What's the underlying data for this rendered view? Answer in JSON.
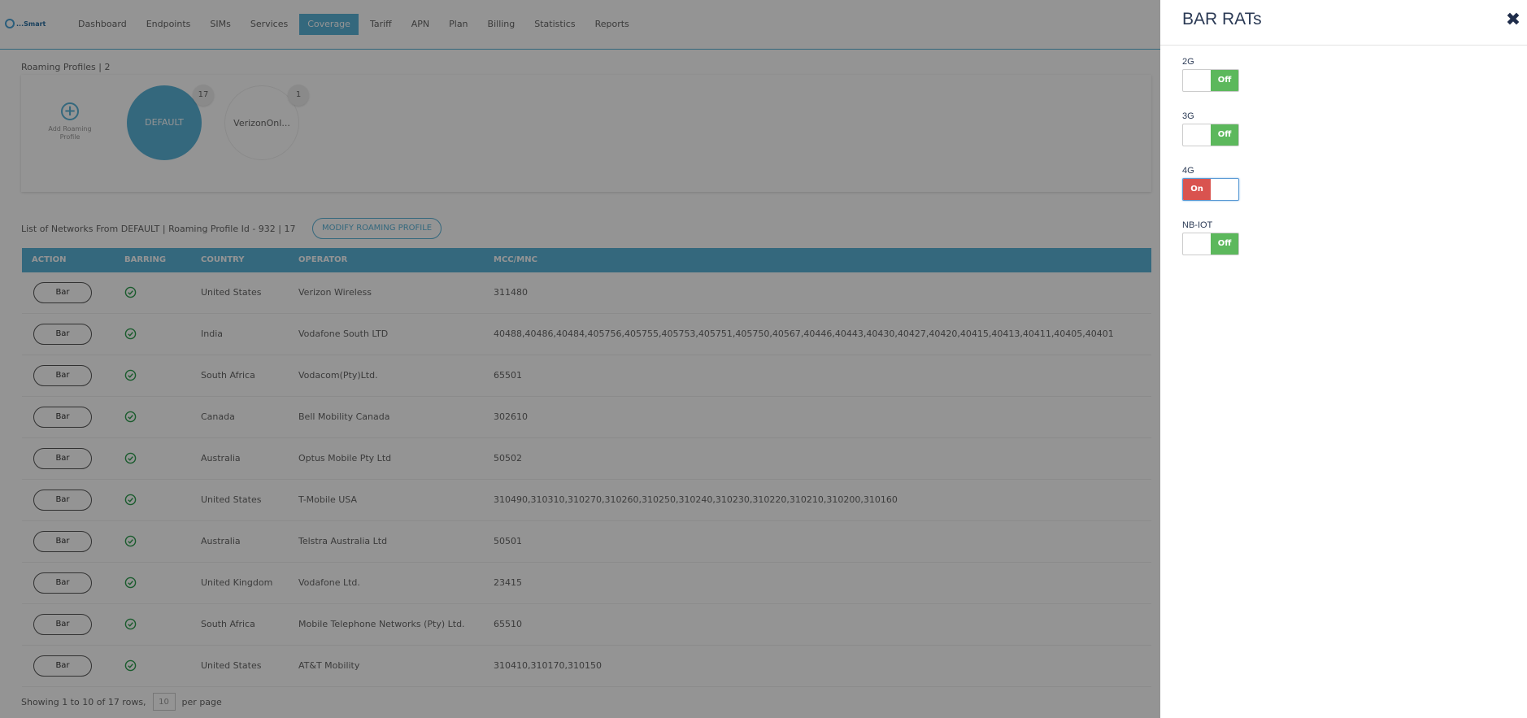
{
  "header": {
    "logo_text": "...Smart",
    "nav": [
      "Dashboard",
      "Endpoints",
      "SIMs",
      "Services",
      "Coverage",
      "Tariff",
      "APN",
      "Plan",
      "Billing",
      "Statistics",
      "Reports"
    ],
    "active_nav": "Coverage"
  },
  "profiles": {
    "heading": "Roaming Profiles  |  2",
    "add_label": "Add Roaming Profile",
    "items": [
      {
        "name": "DEFAULT",
        "count": "17"
      },
      {
        "name": "VerizonOnl...",
        "count": "1"
      }
    ]
  },
  "list": {
    "title": "List of Networks From DEFAULT | Roaming Profile Id - 932  |  17",
    "modify_label": "MODIFY ROAMING PROFILE",
    "columns": [
      "ACTION",
      "BARRING",
      "COUNTRY",
      "OPERATOR",
      "MCC/MNC"
    ],
    "action_label": "Bar",
    "rows": [
      {
        "country": "United States",
        "operator": "Verizon Wireless",
        "mcc": "311480"
      },
      {
        "country": "India",
        "operator": "Vodafone South LTD",
        "mcc": "40488,40486,40484,405756,405755,405753,405751,405750,40567,40446,40443,40430,40427,40420,40415,40413,40411,40405,40401"
      },
      {
        "country": "South Africa",
        "operator": "Vodacom(Pty)Ltd.",
        "mcc": "65501"
      },
      {
        "country": "Canada",
        "operator": "Bell Mobility Canada",
        "mcc": "302610"
      },
      {
        "country": "Australia",
        "operator": "Optus Mobile Pty Ltd",
        "mcc": "50502"
      },
      {
        "country": "United States",
        "operator": "T-Mobile USA",
        "mcc": "310490,310310,310270,310260,310250,310240,310230,310220,310210,310200,310160"
      },
      {
        "country": "Australia",
        "operator": "Telstra Australia Ltd",
        "mcc": "50501"
      },
      {
        "country": "United Kingdom",
        "operator": "Vodafone Ltd.",
        "mcc": "23415"
      },
      {
        "country": "South Africa",
        "operator": "Mobile Telephone Networks (Pty) Ltd.",
        "mcc": "65510"
      },
      {
        "country": "United States",
        "operator": "AT&T Mobility",
        "mcc": "310410,310170,310150"
      }
    ],
    "footer_left": "Showing 1 to 10 of 17 rows,",
    "page_size": "10",
    "footer_right": "per page"
  },
  "panel": {
    "title": "BAR RATs",
    "close_icon": "close-icon",
    "rats": [
      {
        "label": "2G",
        "state": "Off"
      },
      {
        "label": "3G",
        "state": "Off"
      },
      {
        "label": "4G",
        "state": "On"
      },
      {
        "label": "NB-IOT",
        "state": "Off"
      }
    ]
  },
  "colors": {
    "accent": "#5bb3d8",
    "toggle_off": "#5cb85c",
    "toggle_on": "#d9534f",
    "panel_title": "#2b3a55"
  }
}
